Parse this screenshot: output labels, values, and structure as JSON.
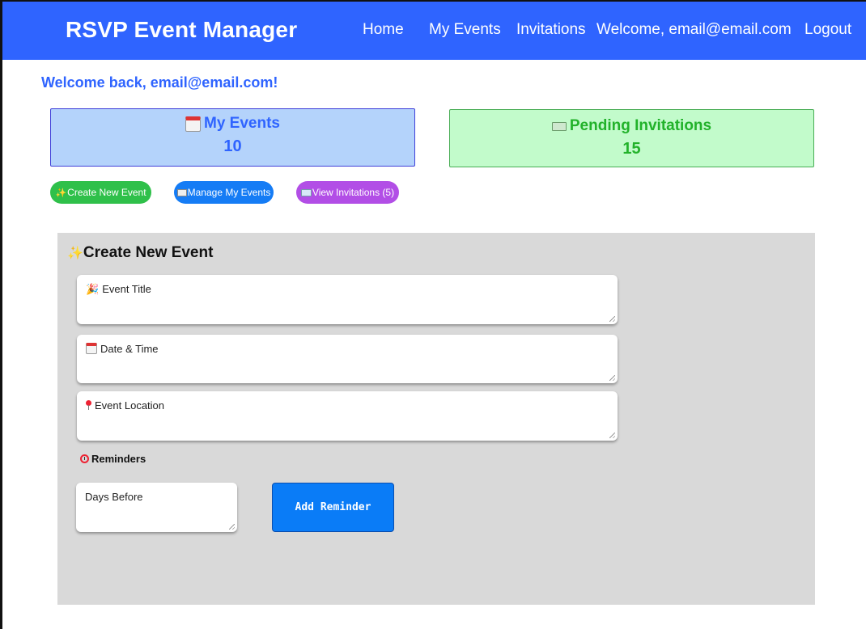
{
  "header": {
    "brand": "RSVP Event Manager",
    "nav": {
      "home": "Home",
      "my_events": "My Events",
      "invitations": "Invitations",
      "welcome": "Welcome, email@email.com",
      "logout": "Logout"
    },
    "background_color": "#2f64ff"
  },
  "greeting": "Welcome back, email@email.com!",
  "stats": {
    "my_events": {
      "icon": "calendar-icon",
      "label": "My Events",
      "count": "10"
    },
    "pending_invitations": {
      "icon": "money-icon",
      "label": "Pending Invitations",
      "count": "15"
    }
  },
  "actions": {
    "create": {
      "icon": "sparkles-icon",
      "label": "Create New Event",
      "color": "#2fc04a"
    },
    "manage": {
      "icon": "notepad-icon",
      "label": "Manage My Events",
      "color": "#157cf5"
    },
    "invitations": {
      "icon": "envelope-icon",
      "label": "View Invitations (5)",
      "color": "#b24ee6"
    }
  },
  "create_form": {
    "title": "Create New Event",
    "title_icon": "sparkles-icon",
    "fields": {
      "event_title": {
        "icon": "party-popper-icon",
        "placeholder": "Event Title"
      },
      "date_time": {
        "icon": "calendar-icon",
        "placeholder": "Date & Time"
      },
      "location": {
        "icon": "pin-icon",
        "placeholder": "Event Location"
      }
    },
    "reminders": {
      "icon": "alarm-clock-icon",
      "label": "Reminders",
      "days_placeholder": "Days Before",
      "add_button": "Add Reminder"
    }
  }
}
